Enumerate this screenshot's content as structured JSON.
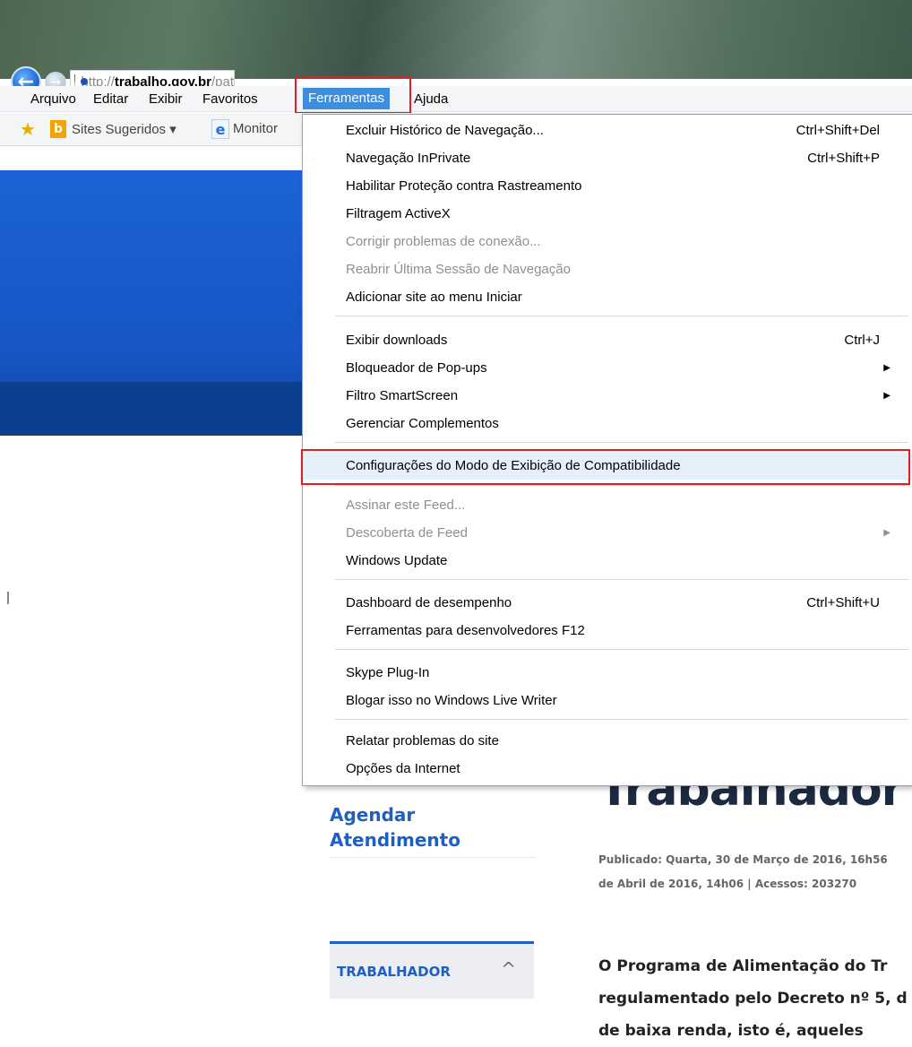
{
  "address_bar": {
    "url_scheme": "http://",
    "url_host": "trabalho.gov.br",
    "url_path": "/pat"
  },
  "menu_bar": {
    "items": [
      "Arquivo",
      "Editar",
      "Exibir",
      "Favoritos",
      "Ferramentas",
      "Ajuda"
    ],
    "active": "Ferramentas"
  },
  "favorites_bar": {
    "suggested_sites": "Sites Sugeridos ▾",
    "monitor": "Monitor"
  },
  "tools_menu": {
    "items": [
      {
        "label": "Excluir Histórico de Navegação...",
        "shortcut": "Ctrl+Shift+Del",
        "enabled": true
      },
      {
        "label": "Navegação InPrivate",
        "shortcut": "Ctrl+Shift+P",
        "enabled": true
      },
      {
        "label": "Habilitar Proteção contra Rastreamento",
        "shortcut": "",
        "enabled": true
      },
      {
        "label": "Filtragem ActiveX",
        "shortcut": "",
        "enabled": true
      },
      {
        "label": "Corrigir problemas de conexão...",
        "shortcut": "",
        "enabled": false
      },
      {
        "label": "Reabrir Última Sessão de Navegação",
        "shortcut": "",
        "enabled": false
      },
      {
        "label": "Adicionar site ao menu Iniciar",
        "shortcut": "",
        "enabled": true
      },
      {
        "label": "Exibir downloads",
        "shortcut": "Ctrl+J",
        "enabled": true
      },
      {
        "label": "Bloqueador de Pop-ups",
        "shortcut": "",
        "submenu": true,
        "enabled": true
      },
      {
        "label": "Filtro SmartScreen",
        "shortcut": "",
        "submenu": true,
        "enabled": true
      },
      {
        "label": "Gerenciar Complementos",
        "shortcut": "",
        "enabled": true
      },
      {
        "label": "Configurações do Modo de Exibição de Compatibilidade",
        "shortcut": "",
        "enabled": true,
        "highlighted": true
      },
      {
        "label": "Assinar este Feed...",
        "shortcut": "",
        "enabled": false
      },
      {
        "label": "Descoberta de Feed",
        "shortcut": "",
        "submenu": true,
        "enabled": false
      },
      {
        "label": "Windows Update",
        "shortcut": "",
        "enabled": true
      },
      {
        "label": "Dashboard de desempenho",
        "shortcut": "Ctrl+Shift+U",
        "enabled": true
      },
      {
        "label": "Ferramentas para desenvolvedores F12",
        "shortcut": "",
        "enabled": true
      },
      {
        "label": "Skype Plug-In",
        "shortcut": "",
        "enabled": true
      },
      {
        "label": "Blogar isso no Windows Live Writer",
        "shortcut": "",
        "enabled": true
      },
      {
        "label": "Relatar problemas do site",
        "shortcut": "",
        "enabled": true
      },
      {
        "label": "Opções da Internet",
        "shortcut": "",
        "enabled": true
      }
    ]
  },
  "page": {
    "headline_partial": "Trabalhador",
    "side_link_line1": "Agendar",
    "side_link_line2": "Atendimento",
    "published_line1": "Publicado: Quarta, 30 de Março de 2016, 16h56",
    "published_line2": "de Abril de 2016, 14h06 | Acessos: 203270",
    "side_card_label": "TRABALHADOR",
    "body_line1": "O Programa de Alimentação do Tr",
    "body_line2": "regulamentado pelo Decreto nº 5, d",
    "body_line3": "de baixa renda, isto é, aqueles"
  },
  "colors": {
    "menu_active_bg": "#3e8ede",
    "highlight_border": "#e02020",
    "site_blue": "#1c63d6",
    "link_blue": "#1d5fc2"
  }
}
